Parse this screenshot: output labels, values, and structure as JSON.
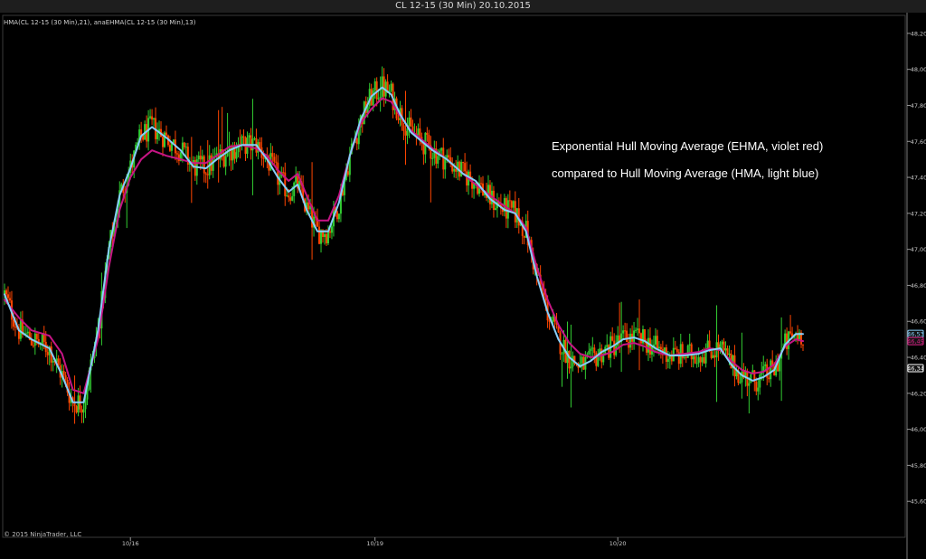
{
  "window": {
    "title": "CL 12-15 (30 Min)  20.10.2015"
  },
  "chart_data": {
    "type": "candlestick",
    "indicator_label": "HMA(CL 12-15 (30 Min),21), anaEHMA(CL 12-15 (30 Min),13)",
    "copyright": "© 2015 NinjaTrader, LLC",
    "annotation": [
      "Exponential Hull Moving Average (EHMA, violet red)",
      "compared to Hull Moving Average (HMA, light blue)"
    ],
    "ylim": [
      45.4,
      48.3
    ],
    "y_ticks": [
      "48,20",
      "48,00",
      "47,80",
      "47,60",
      "47,40",
      "47,20",
      "47,00",
      "46,80",
      "46,60",
      "46,40",
      "46,20",
      "46,00",
      "45,80",
      "45,60"
    ],
    "y_tick_values": [
      48.2,
      48.0,
      47.8,
      47.6,
      47.4,
      47.2,
      47.0,
      46.8,
      46.6,
      46.4,
      46.2,
      46.0,
      45.8,
      45.6
    ],
    "x_ticks": [
      {
        "label": "10/16",
        "bar": 70
      },
      {
        "label": "10/19",
        "bar": 206
      },
      {
        "label": "10/20",
        "bar": 341
      }
    ],
    "price_markers": [
      {
        "label": "46,53",
        "value": 46.53,
        "color": "#87cefa"
      },
      {
        "label": "46,49",
        "value": 46.49,
        "color": "#e0218a"
      },
      {
        "label": "46,34",
        "value": 46.34,
        "color": "#ffffff"
      }
    ],
    "series": [
      {
        "name": "HMA",
        "color": "#87cefa",
        "points": [
          [
            0,
            46.75
          ],
          [
            8,
            46.55
          ],
          [
            15,
            46.5
          ],
          [
            25,
            46.45
          ],
          [
            32,
            46.3
          ],
          [
            38,
            46.15
          ],
          [
            44,
            46.15
          ],
          [
            52,
            46.55
          ],
          [
            58,
            47.0
          ],
          [
            64,
            47.3
          ],
          [
            70,
            47.45
          ],
          [
            76,
            47.63
          ],
          [
            82,
            47.68
          ],
          [
            90,
            47.62
          ],
          [
            98,
            47.55
          ],
          [
            105,
            47.46
          ],
          [
            112,
            47.45
          ],
          [
            118,
            47.5
          ],
          [
            125,
            47.55
          ],
          [
            132,
            47.58
          ],
          [
            140,
            47.58
          ],
          [
            146,
            47.5
          ],
          [
            152,
            47.4
          ],
          [
            158,
            47.32
          ],
          [
            163,
            47.36
          ],
          [
            168,
            47.22
          ],
          [
            174,
            47.1
          ],
          [
            180,
            47.1
          ],
          [
            186,
            47.26
          ],
          [
            192,
            47.52
          ],
          [
            198,
            47.72
          ],
          [
            204,
            47.85
          ],
          [
            210,
            47.9
          ],
          [
            215,
            47.86
          ],
          [
            220,
            47.75
          ],
          [
            226,
            47.65
          ],
          [
            232,
            47.6
          ],
          [
            238,
            47.55
          ],
          [
            246,
            47.5
          ],
          [
            255,
            47.42
          ],
          [
            262,
            47.38
          ],
          [
            270,
            47.28
          ],
          [
            278,
            47.22
          ],
          [
            284,
            47.2
          ],
          [
            290,
            47.1
          ],
          [
            296,
            46.85
          ],
          [
            302,
            46.65
          ],
          [
            308,
            46.5
          ],
          [
            314,
            46.4
          ],
          [
            320,
            46.35
          ],
          [
            326,
            46.38
          ],
          [
            332,
            46.43
          ],
          [
            338,
            46.46
          ],
          [
            344,
            46.5
          ],
          [
            350,
            46.51
          ],
          [
            356,
            46.49
          ],
          [
            362,
            46.45
          ],
          [
            370,
            46.41
          ],
          [
            378,
            46.41
          ],
          [
            386,
            46.42
          ],
          [
            392,
            46.44
          ],
          [
            398,
            46.45
          ],
          [
            404,
            46.36
          ],
          [
            410,
            46.3
          ],
          [
            416,
            46.27
          ],
          [
            422,
            46.29
          ],
          [
            428,
            46.33
          ],
          [
            434,
            46.47
          ],
          [
            440,
            46.53
          ],
          [
            444,
            46.53
          ]
        ]
      },
      {
        "name": "EHMA",
        "color": "#c71585",
        "points": [
          [
            0,
            46.72
          ],
          [
            8,
            46.62
          ],
          [
            15,
            46.55
          ],
          [
            25,
            46.52
          ],
          [
            32,
            46.42
          ],
          [
            38,
            46.22
          ],
          [
            44,
            46.2
          ],
          [
            52,
            46.5
          ],
          [
            58,
            46.9
          ],
          [
            64,
            47.22
          ],
          [
            70,
            47.4
          ],
          [
            76,
            47.5
          ],
          [
            82,
            47.55
          ],
          [
            90,
            47.52
          ],
          [
            98,
            47.5
          ],
          [
            105,
            47.48
          ],
          [
            112,
            47.48
          ],
          [
            118,
            47.52
          ],
          [
            125,
            47.57
          ],
          [
            132,
            47.58
          ],
          [
            140,
            47.56
          ],
          [
            146,
            47.52
          ],
          [
            152,
            47.44
          ],
          [
            158,
            47.38
          ],
          [
            163,
            47.42
          ],
          [
            168,
            47.3
          ],
          [
            174,
            47.16
          ],
          [
            180,
            47.16
          ],
          [
            186,
            47.3
          ],
          [
            192,
            47.52
          ],
          [
            198,
            47.7
          ],
          [
            204,
            47.78
          ],
          [
            210,
            47.84
          ],
          [
            215,
            47.82
          ],
          [
            220,
            47.74
          ],
          [
            226,
            47.66
          ],
          [
            232,
            47.61
          ],
          [
            238,
            47.56
          ],
          [
            246,
            47.5
          ],
          [
            255,
            47.42
          ],
          [
            262,
            47.36
          ],
          [
            270,
            47.3
          ],
          [
            278,
            47.24
          ],
          [
            284,
            47.2
          ],
          [
            290,
            47.12
          ],
          [
            296,
            46.9
          ],
          [
            302,
            46.72
          ],
          [
            308,
            46.58
          ],
          [
            314,
            46.48
          ],
          [
            320,
            46.42
          ],
          [
            326,
            46.4
          ],
          [
            332,
            46.41
          ],
          [
            338,
            46.43
          ],
          [
            344,
            46.47
          ],
          [
            350,
            46.48
          ],
          [
            356,
            46.46
          ],
          [
            362,
            46.43
          ],
          [
            370,
            46.41
          ],
          [
            378,
            46.42
          ],
          [
            386,
            46.43
          ],
          [
            392,
            46.45
          ],
          [
            398,
            46.44
          ],
          [
            404,
            46.38
          ],
          [
            410,
            46.33
          ],
          [
            416,
            46.31
          ],
          [
            422,
            46.32
          ],
          [
            428,
            46.36
          ],
          [
            434,
            46.46
          ],
          [
            440,
            46.5
          ],
          [
            444,
            46.49
          ]
        ]
      }
    ]
  }
}
